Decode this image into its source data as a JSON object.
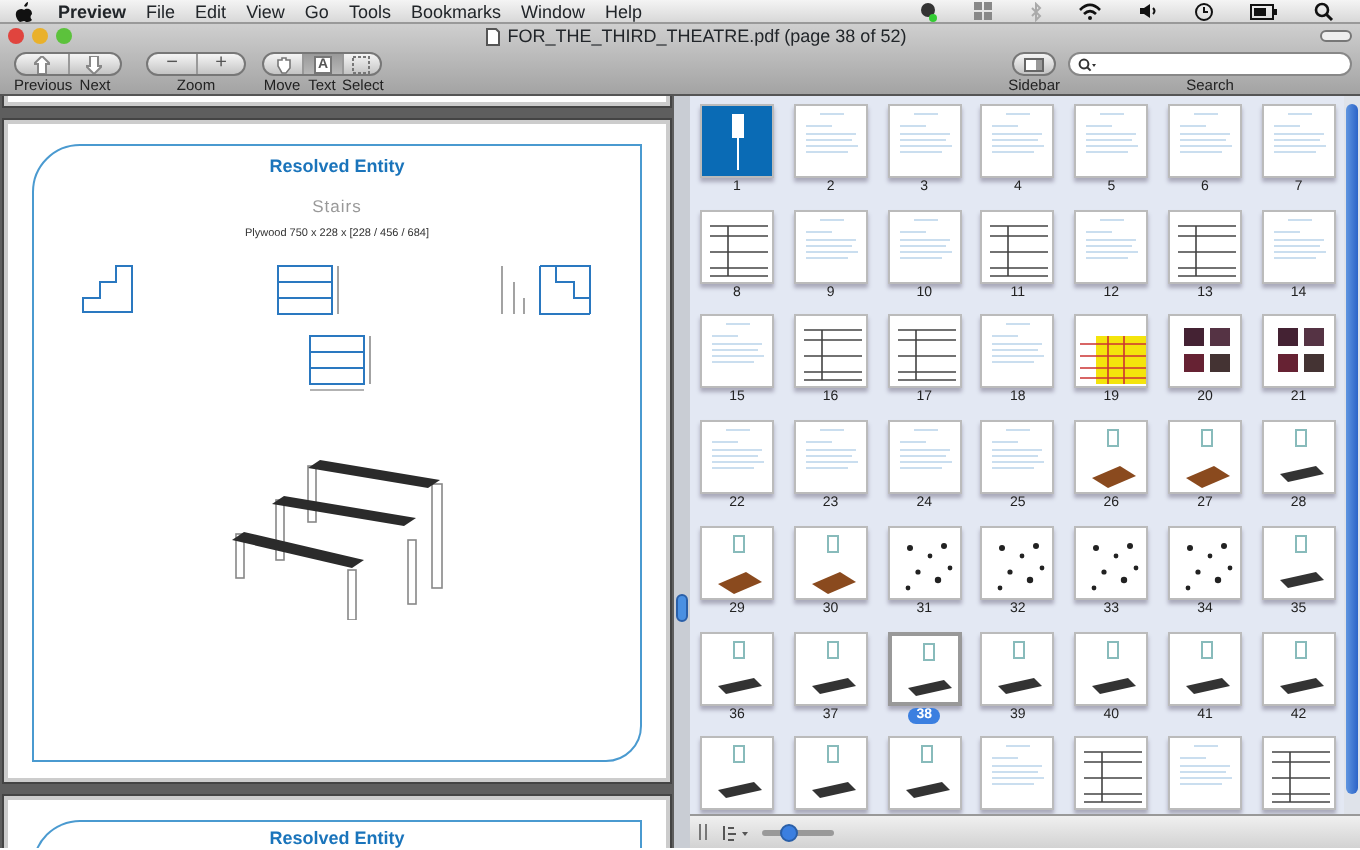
{
  "menu_bar": {
    "app": "Preview",
    "items": [
      "File",
      "Edit",
      "View",
      "Go",
      "Tools",
      "Bookmarks",
      "Window",
      "Help"
    ]
  },
  "window": {
    "title": "FOR_THE_THIRD_THEATRE.pdf (page 38 of 52)"
  },
  "toolbar": {
    "navigation": [
      {
        "label": "Previous",
        "kind": "up"
      },
      {
        "label": "Next",
        "kind": "down"
      }
    ],
    "zoom": {
      "label": "Zoom",
      "buttons": [
        "−",
        "+"
      ]
    },
    "tools": [
      {
        "label": "Move",
        "kind": "hand",
        "selected": false
      },
      {
        "label": "Text",
        "kind": "text",
        "glyph": "A",
        "selected": true
      },
      {
        "label": "Select",
        "kind": "marquee",
        "selected": false
      }
    ],
    "sidebar": {
      "label": "Sidebar"
    },
    "search": {
      "label": "Search"
    }
  },
  "document": {
    "pages": [
      {
        "kind": "tail"
      },
      {
        "kind": "full",
        "title": "Resolved Entity",
        "subtitle": "Stairs",
        "caption": "Plywood 750 x 228 x [228 / 456 / 684]"
      },
      {
        "kind": "head",
        "title": "Resolved Entity"
      }
    ]
  },
  "thumbnails": [
    {
      "label": "1",
      "kind": "cover",
      "selected": false
    },
    {
      "label": "2",
      "kind": "text",
      "selected": false
    },
    {
      "label": "3",
      "kind": "text",
      "selected": false
    },
    {
      "label": "4",
      "kind": "text",
      "selected": false
    },
    {
      "label": "5",
      "kind": "text",
      "selected": false
    },
    {
      "label": "6",
      "kind": "text",
      "selected": false
    },
    {
      "label": "7",
      "kind": "text",
      "selected": false
    },
    {
      "label": "8",
      "kind": "table",
      "selected": false
    },
    {
      "label": "9",
      "kind": "text",
      "selected": false
    },
    {
      "label": "10",
      "kind": "text",
      "selected": false
    },
    {
      "label": "11",
      "kind": "table",
      "selected": false
    },
    {
      "label": "12",
      "kind": "text",
      "selected": false
    },
    {
      "label": "13",
      "kind": "table",
      "selected": false
    },
    {
      "label": "14",
      "kind": "text",
      "selected": false
    },
    {
      "label": "15",
      "kind": "text",
      "selected": false
    },
    {
      "label": "16",
      "kind": "table",
      "selected": false
    },
    {
      "label": "17",
      "kind": "table",
      "selected": false
    },
    {
      "label": "18",
      "kind": "text",
      "selected": false
    },
    {
      "label": "19",
      "kind": "grid",
      "selected": false
    },
    {
      "label": "20",
      "kind": "photo",
      "selected": false
    },
    {
      "label": "21",
      "kind": "photo",
      "selected": false
    },
    {
      "label": "22",
      "kind": "text",
      "selected": false
    },
    {
      "label": "23",
      "kind": "text",
      "selected": false
    },
    {
      "label": "24",
      "kind": "text",
      "selected": false
    },
    {
      "label": "25",
      "kind": "text",
      "selected": false
    },
    {
      "label": "26",
      "kind": "wood",
      "selected": false
    },
    {
      "label": "27",
      "kind": "wood",
      "selected": false
    },
    {
      "label": "28",
      "kind": "model",
      "selected": false
    },
    {
      "label": "29",
      "kind": "wood",
      "selected": false
    },
    {
      "label": "30",
      "kind": "wood",
      "selected": false
    },
    {
      "label": "31",
      "kind": "sketch",
      "selected": false
    },
    {
      "label": "32",
      "kind": "sketch",
      "selected": false
    },
    {
      "label": "33",
      "kind": "sketch",
      "selected": false
    },
    {
      "label": "34",
      "kind": "sketch",
      "selected": false
    },
    {
      "label": "35",
      "kind": "model",
      "selected": false
    },
    {
      "label": "36",
      "kind": "model",
      "selected": false
    },
    {
      "label": "37",
      "kind": "model",
      "selected": false
    },
    {
      "label": "38",
      "kind": "model",
      "selected": true
    },
    {
      "label": "39",
      "kind": "model",
      "selected": false
    },
    {
      "label": "40",
      "kind": "model",
      "selected": false
    },
    {
      "label": "41",
      "kind": "model",
      "selected": false
    },
    {
      "label": "42",
      "kind": "model",
      "selected": false
    },
    {
      "kind": "model",
      "selected": false
    },
    {
      "kind": "model",
      "selected": false
    },
    {
      "kind": "model",
      "selected": false
    },
    {
      "kind": "text",
      "selected": false
    },
    {
      "kind": "table",
      "selected": false
    },
    {
      "kind": "text",
      "selected": false
    },
    {
      "kind": "table",
      "selected": false
    }
  ],
  "bottom_bar": {
    "thumbnail_size": {
      "level": 0.35
    }
  }
}
